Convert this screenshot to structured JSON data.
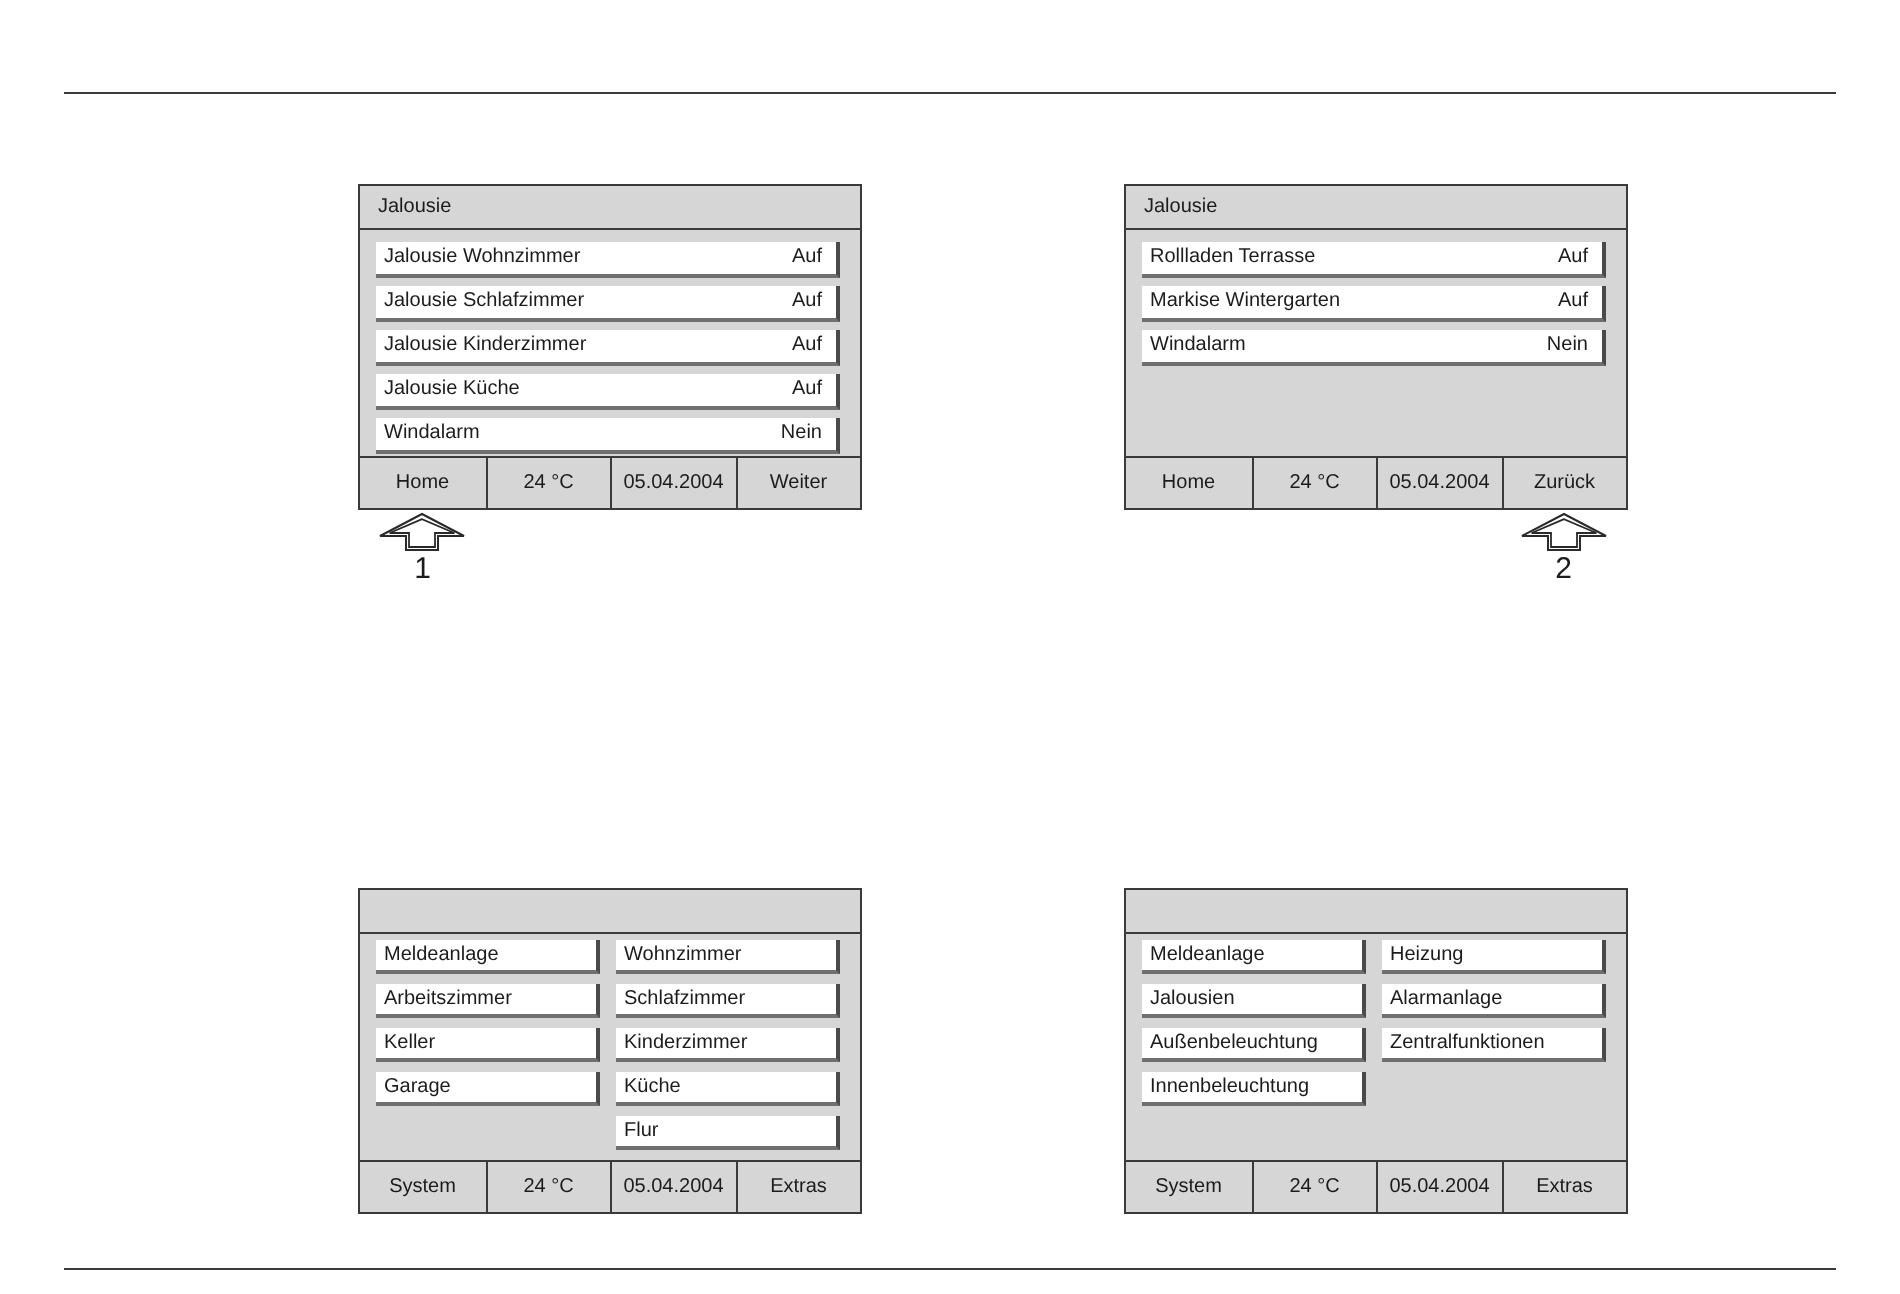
{
  "panels": [
    {
      "kind": "list",
      "title": "Jalousie",
      "rows": [
        {
          "label": "Jalousie Wohnzimmer",
          "value": "Auf"
        },
        {
          "label": "Jalousie Schlafzimmer",
          "value": "Auf"
        },
        {
          "label": "Jalousie Kinderzimmer",
          "value": "Auf"
        },
        {
          "label": "Jalousie Küche",
          "value": "Auf"
        },
        {
          "label": "Windalarm",
          "value": "Nein"
        }
      ],
      "footer": [
        {
          "label": "Home",
          "callout": "1"
        },
        {
          "label": "24 °C"
        },
        {
          "label": "05.04.2004"
        },
        {
          "label": "Weiter"
        }
      ]
    },
    {
      "kind": "list",
      "title": "Jalousie",
      "rows": [
        {
          "label": "Rollladen Terrasse",
          "value": "Auf"
        },
        {
          "label": "Markise Wintergarten",
          "value": "Auf"
        },
        {
          "label": "Windalarm",
          "value": "Nein"
        }
      ],
      "footer": [
        {
          "label": "Home"
        },
        {
          "label": "24 °C"
        },
        {
          "label": "05.04.2004"
        },
        {
          "label": "Zurück",
          "callout": "2"
        }
      ]
    },
    {
      "kind": "menu",
      "columns": [
        [
          "Meldeanlage",
          "Arbeitszimmer",
          "Keller",
          "Garage"
        ],
        [
          "Wohnzimmer",
          "Schlafzimmer",
          "Kinderzimmer",
          "Küche",
          "Flur"
        ]
      ],
      "footer": [
        {
          "label": "System"
        },
        {
          "label": "24 °C"
        },
        {
          "label": "05.04.2004"
        },
        {
          "label": "Extras"
        }
      ]
    },
    {
      "kind": "menu",
      "columns": [
        [
          "Meldeanlage",
          "Jalousien",
          "Außenbeleuchtung",
          "Innenbeleuchtung"
        ],
        [
          "Heizung",
          "Alarmanlage",
          "Zentralfunktionen"
        ]
      ],
      "footer": [
        {
          "label": "System"
        },
        {
          "label": "24 °C"
        },
        {
          "label": "05.04.2004"
        },
        {
          "label": "Extras"
        }
      ]
    }
  ]
}
